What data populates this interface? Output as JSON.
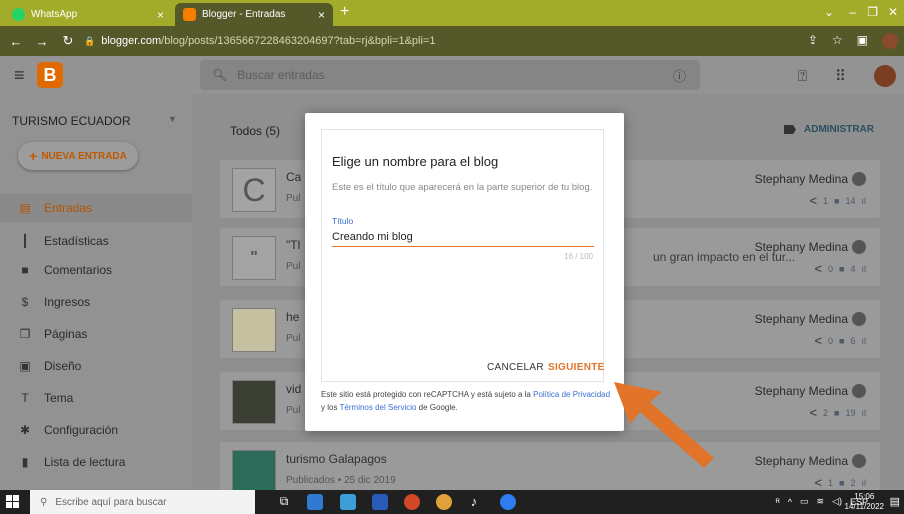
{
  "browser": {
    "tabs": [
      {
        "label": "WhatsApp"
      },
      {
        "label": "Blogger - Entradas"
      }
    ],
    "close_glyph": "×",
    "new_tab_glyph": "+",
    "url_host": "blogger.com",
    "url_path": "/blog/posts/1365667228463204697?tab=rj&bpli=1&pli=1"
  },
  "header": {
    "logo_letter": "B",
    "search_placeholder": "Buscar entradas"
  },
  "sidebar": {
    "blog_name": "TURISMO ECUADOR",
    "new_post": "NUEVA ENTRADA",
    "items": [
      {
        "label": "Entradas",
        "icon": "▤"
      },
      {
        "label": "Estadísticas",
        "icon": "┃"
      },
      {
        "label": "Comentarios",
        "icon": "■"
      },
      {
        "label": "Ingresos",
        "icon": "$"
      },
      {
        "label": "Páginas",
        "icon": "❐"
      },
      {
        "label": "Diseño",
        "icon": "▣"
      },
      {
        "label": "Tema",
        "icon": "T"
      },
      {
        "label": "Configuración",
        "icon": "✱"
      },
      {
        "label": "Lista de lectura",
        "icon": "▮"
      }
    ]
  },
  "main": {
    "filter_label": "Todos (5)",
    "admin_label": "ADMINISTRAR",
    "posts": [
      {
        "title": "Ca",
        "sub": "Pul",
        "thumb": "C",
        "author": "Stephany Medina",
        "comments": "1",
        "views": "14"
      },
      {
        "title": "\"Tl",
        "sub": "Pul",
        "thumb": "\"",
        "trail": "un gran impacto en el tur...",
        "author": "Stephany Medina",
        "comments": "0",
        "views": "4"
      },
      {
        "title": "he",
        "sub": "Pul",
        "thumb": "",
        "author": "Stephany Medina",
        "comments": "0",
        "views": "6"
      },
      {
        "title": "vid",
        "sub": "Pul",
        "thumb": "",
        "author": "Stephany Medina",
        "comments": "2",
        "views": "19"
      },
      {
        "title": "turismo Galapagos",
        "sub": "Publicados • 25 dic 2019",
        "thumb": "",
        "author": "Stephany Medina",
        "comments": "1",
        "views": "2"
      }
    ]
  },
  "modal": {
    "title": "Elige un nombre para el blog",
    "description": "Este es el título que aparecerá en la parte superior de tu blog.",
    "field_label": "Título",
    "field_value": "Creando mi blog",
    "counter": "16 / 100",
    "cancel": "CANCELAR",
    "next": "SIGUIENTE",
    "footer_prefix": "Este sitio está protegido con reCAPTCHA y está sujeto a la ",
    "privacy_link": "Política de Privacidad",
    "footer_mid": " y los ",
    "terms_link": "Términos del Servicio",
    "footer_suffix": " de Google."
  },
  "taskbar": {
    "search_placeholder": "Escribe aquí para buscar",
    "language": "ESP",
    "time": "15:06",
    "date": "14/11/2022"
  },
  "colors": {
    "accent_orange": "#e2742a",
    "link_blue": "#3a6fd0",
    "chrome_frame": "#a2ac2a"
  }
}
